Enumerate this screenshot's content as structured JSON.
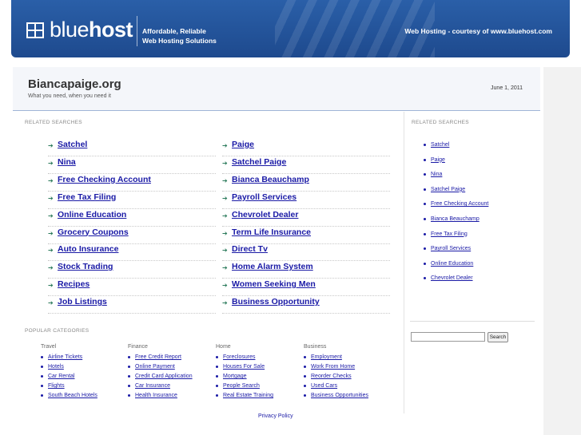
{
  "header": {
    "logo_light": "blue",
    "logo_bold": "host",
    "tagline_1": "Affordable, Reliable",
    "tagline_2": "Web Hosting Solutions",
    "courtesy": "Web Hosting - courtesy of www.bluehost.com",
    "brand_color": "#1f4f96"
  },
  "site": {
    "title": "Biancapaige.org",
    "subtitle": "What you need, when you need it",
    "date": "June 1, 2011"
  },
  "related_label": "RELATED SEARCHES",
  "related_left": [
    "Satchel",
    "Nina",
    "Free Checking Account",
    "Free Tax Filing",
    "Online Education",
    "Grocery Coupons",
    "Auto Insurance",
    "Stock Trading",
    "Recipes",
    "Job Listings"
  ],
  "related_right": [
    "Paige",
    "Satchel Paige",
    "Bianca Beauchamp",
    "Payroll Services",
    "Chevrolet Dealer",
    "Term Life Insurance",
    "Direct Tv",
    "Home Alarm System",
    "Women Seeking Men",
    "Business Opportunity"
  ],
  "sidebar": {
    "label": "RELATED SEARCHES",
    "items": [
      "Satchel",
      "Paige",
      "Nina",
      "Satchel Paige",
      "Free Checking Account",
      "Bianca Beauchamp",
      "Free Tax Filing",
      "Payroll Services",
      "Online Education",
      "Chevrolet Dealer"
    ],
    "search_button": "Search",
    "search_value": ""
  },
  "popular": {
    "label": "POPULAR CATEGORIES",
    "categories": [
      {
        "name": "Travel",
        "items": [
          "Airline Tickets",
          "Hotels",
          "Car Rental",
          "Flights",
          "South Beach Hotels"
        ]
      },
      {
        "name": "Finance",
        "items": [
          "Free Credit Report",
          "Online Payment",
          "Credit Card Application",
          "Car Insurance",
          "Health Insurance"
        ]
      },
      {
        "name": "Home",
        "items": [
          "Foreclosures",
          "Houses For Sale",
          "Mortgage",
          "People Search",
          "Real Estate Training"
        ]
      },
      {
        "name": "Business",
        "items": [
          "Employment",
          "Work From Home",
          "Reorder Checks",
          "Used Cars",
          "Business Opportunities"
        ]
      }
    ]
  },
  "footer": {
    "privacy": "Privacy Policy"
  }
}
